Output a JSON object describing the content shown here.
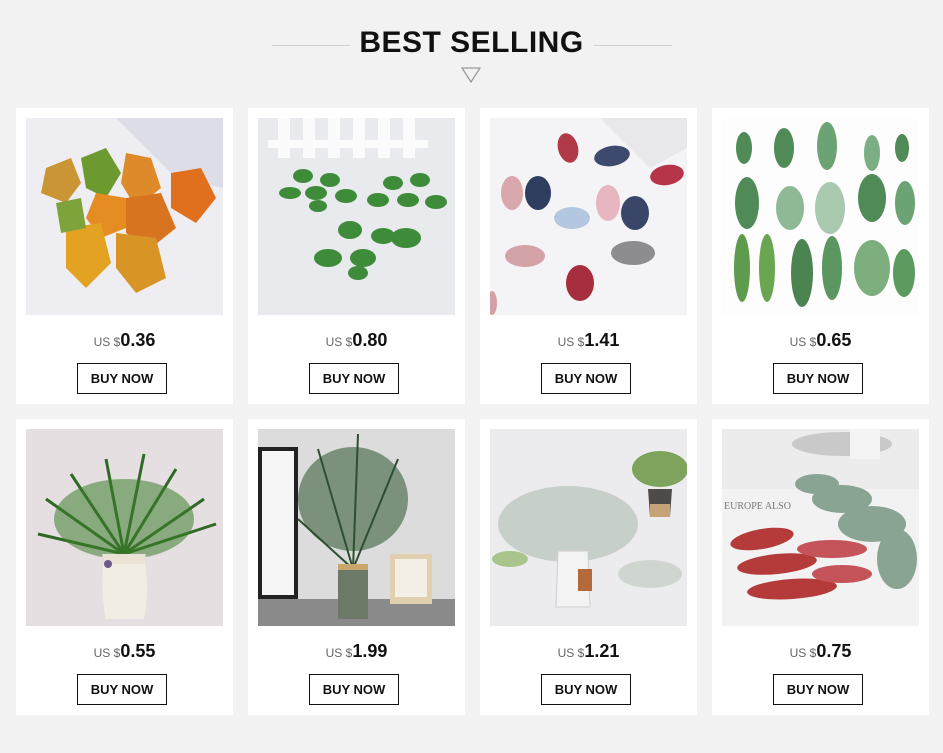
{
  "header": {
    "title": "BEST SELLING"
  },
  "currency_prefix": "US $",
  "buy_label": "BUY NOW",
  "products": [
    {
      "price": "0.36",
      "image": "maple-leaves"
    },
    {
      "price": "0.80",
      "image": "green-leaf-sprigs"
    },
    {
      "price": "1.41",
      "image": "fabric-leaves"
    },
    {
      "price": "0.65",
      "image": "fern-assortment"
    },
    {
      "price": "0.55",
      "image": "pine-in-vase"
    },
    {
      "price": "1.99",
      "image": "eucalyptus-in-vase"
    },
    {
      "price": "1.21",
      "image": "silver-plant-in-jar"
    },
    {
      "price": "0.75",
      "image": "red-green-eucalyptus"
    }
  ]
}
